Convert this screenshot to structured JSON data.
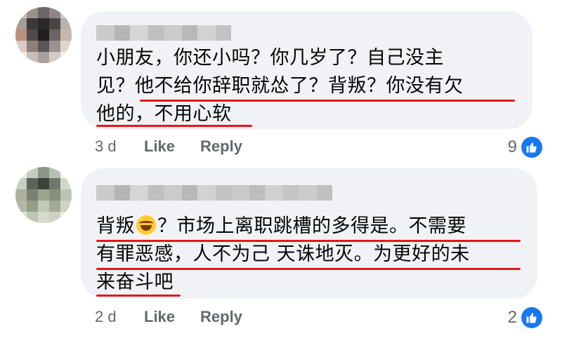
{
  "comments": [
    {
      "lines": [
        "小朋友，你还小吗？你几岁了？自己没主",
        "见？他不给你辞职就怂了？背叛？你没有欠",
        "他的，不用心软"
      ],
      "time": "3 d",
      "like_label": "Like",
      "reply_label": "Reply",
      "reaction_count": "9"
    },
    {
      "line1_pre": "背叛",
      "line1_post": "？市场上离职跳槽的多得是。不需要",
      "lines_rest": [
        "有罪恶感，人不为己 天诛地灭。为更好的未",
        "来奋斗吧"
      ],
      "emoji": "laughing-tears-emoji",
      "time": "2 d",
      "like_label": "Like",
      "reply_label": "Reply",
      "reaction_count": "2"
    }
  ],
  "colors": {
    "bubble": "#f0f2f5",
    "underline": "#e4161c",
    "like_blue": "#1877f2",
    "meta_text": "#65676b"
  }
}
